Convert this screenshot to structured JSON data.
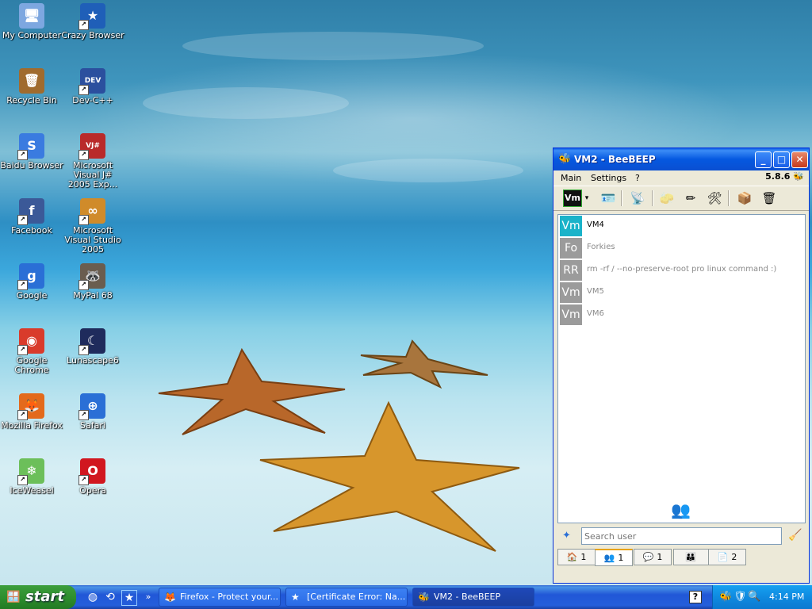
{
  "desktop": {
    "icons": [
      {
        "label": "My Computer",
        "icon": "my-computer-icon",
        "glyph": "🖥",
        "color": "#7da7e0"
      },
      {
        "label": "Crazy Browser",
        "icon": "crazy-browser-icon",
        "glyph": "★",
        "color": "#1f5fb8"
      },
      {
        "label": "Recycle Bin",
        "icon": "recycle-bin-icon",
        "glyph": "🗑",
        "color": "#a06b2e"
      },
      {
        "label": "Dev-C++",
        "icon": "dev-cpp-icon",
        "glyph": "DEV",
        "color": "#2b4f9e"
      },
      {
        "label": "Baidu Browser",
        "icon": "baidu-browser-icon",
        "glyph": "S",
        "color": "#3a7be0"
      },
      {
        "label": "Microsoft Visual J# 2005 Exp...",
        "icon": "visual-jsharp-icon",
        "glyph": "VJ#",
        "color": "#b92a2a"
      },
      {
        "label": "Facebook",
        "icon": "facebook-icon",
        "glyph": "f",
        "color": "#3b5998"
      },
      {
        "label": "Microsoft Visual Studio 2005",
        "icon": "visual-studio-icon",
        "glyph": "∞",
        "color": "#d08b2a"
      },
      {
        "label": "Google",
        "icon": "google-icon",
        "glyph": "g",
        "color": "#2a6fd6"
      },
      {
        "label": "MyPal 68",
        "icon": "mypal-icon",
        "glyph": "🦝",
        "color": "#6a5d4f"
      },
      {
        "label": "Google Chrome",
        "icon": "chrome-icon",
        "glyph": "◉",
        "color": "#d93b2b"
      },
      {
        "label": "Lunascape6",
        "icon": "lunascape-icon",
        "glyph": "☾",
        "color": "#1f2b5c"
      },
      {
        "label": "Mozilla Firefox",
        "icon": "firefox-icon",
        "glyph": "🦊",
        "color": "#e36a1c"
      },
      {
        "label": "Safari",
        "icon": "safari-icon",
        "glyph": "⊕",
        "color": "#2a6fd6"
      },
      {
        "label": "IceWeasel",
        "icon": "iceweasel-icon",
        "glyph": "❄",
        "color": "#6cbf5a"
      },
      {
        "label": "Opera",
        "icon": "opera-icon",
        "glyph": "O",
        "color": "#d1171f"
      }
    ]
  },
  "window": {
    "title": "VM2 - BeeBEEP",
    "version": "5.8.6",
    "menu": [
      "Main",
      "Settings",
      "?"
    ],
    "status_badge": "Vm",
    "users": [
      {
        "initials": "Vm",
        "name": "VM4",
        "color": "#1ab3c9",
        "online": true
      },
      {
        "initials": "Fo",
        "name": "Forkies",
        "color": "#9b9b9b",
        "online": false
      },
      {
        "initials": "RR",
        "name": "rm -rf / --no-preserve-root pro linux command :)",
        "color": "#9b9b9b",
        "online": false
      },
      {
        "initials": "Vm",
        "name": "VM5",
        "color": "#9b9b9b",
        "online": false
      },
      {
        "initials": "Vm",
        "name": "VM6",
        "color": "#9b9b9b",
        "online": false
      }
    ],
    "search": {
      "placeholder": "Search user",
      "value": ""
    },
    "tabs": [
      {
        "icon": "home-icon",
        "count": "1"
      },
      {
        "icon": "users-icon",
        "count": "1"
      },
      {
        "icon": "chat-icon",
        "count": "1"
      },
      {
        "icon": "groups-icon",
        "count": ""
      },
      {
        "icon": "file-icon",
        "count": "2"
      }
    ]
  },
  "taskbar": {
    "start_label": "start",
    "tasks": [
      {
        "label": "Firefox - Protect your...",
        "icon": "firefox-task-icon"
      },
      {
        "label": "[Certificate Error: Na...",
        "icon": "crazy-browser-task-icon"
      },
      {
        "label": "VM2 - BeeBEEP",
        "icon": "beebeep-task-icon"
      }
    ],
    "clock": "4:14 PM"
  }
}
